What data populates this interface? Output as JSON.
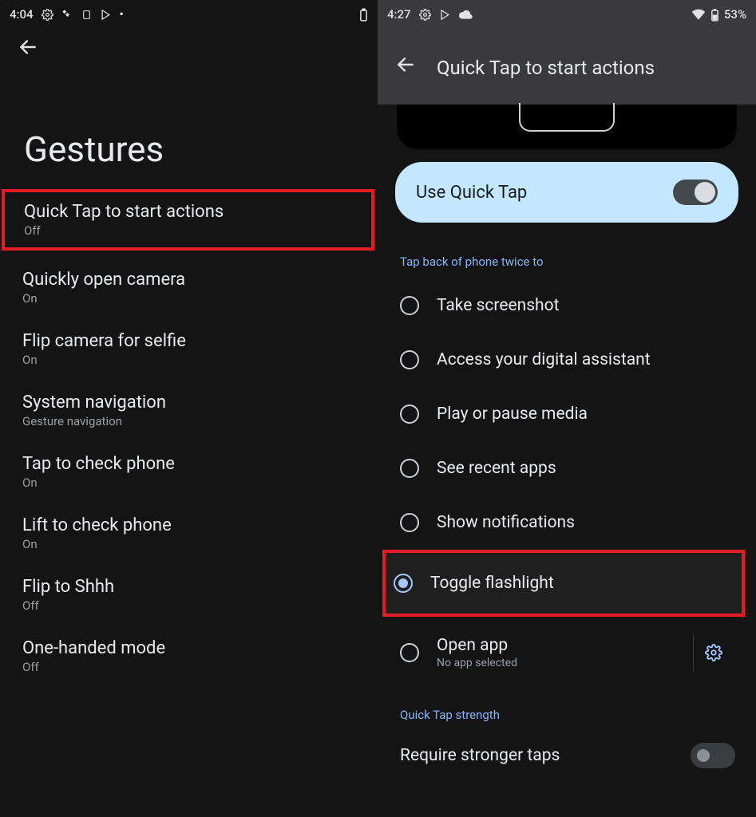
{
  "left": {
    "status_time": "4:04",
    "status_icons": [
      "gear",
      "link",
      "sdcard",
      "play",
      "dot"
    ],
    "status_battery_icon": "battery",
    "title": "Gestures",
    "items": [
      {
        "title": "Quick Tap to start actions",
        "sub": "Off",
        "highlight": true
      },
      {
        "title": "Quickly open camera",
        "sub": "On"
      },
      {
        "title": "Flip camera for selfie",
        "sub": "On"
      },
      {
        "title": "System navigation",
        "sub": "Gesture navigation"
      },
      {
        "title": "Tap to check phone",
        "sub": "On"
      },
      {
        "title": "Lift to check phone",
        "sub": "On"
      },
      {
        "title": "Flip to Shhh",
        "sub": "Off"
      },
      {
        "title": "One-handed mode",
        "sub": "Off"
      }
    ]
  },
  "right": {
    "status_time": "4:27",
    "status_icons": [
      "gear",
      "play",
      "cloud"
    ],
    "battery_text": "53%",
    "title": "Quick Tap to start actions",
    "card_label": "Use Quick Tap",
    "section_label": "Tap back of phone twice to",
    "options": [
      {
        "label": "Take screenshot",
        "selected": false
      },
      {
        "label": "Access your digital assistant",
        "selected": false
      },
      {
        "label": "Play or pause media",
        "selected": false
      },
      {
        "label": "See recent apps",
        "selected": false
      },
      {
        "label": "Show notifications",
        "selected": false
      },
      {
        "label": "Toggle flashlight",
        "selected": true,
        "highlight": true
      },
      {
        "label": "Open app",
        "sub": "No app selected",
        "selected": false,
        "gear": true
      }
    ],
    "strength_header": "Quick Tap strength",
    "strength_label": "Require stronger taps"
  }
}
